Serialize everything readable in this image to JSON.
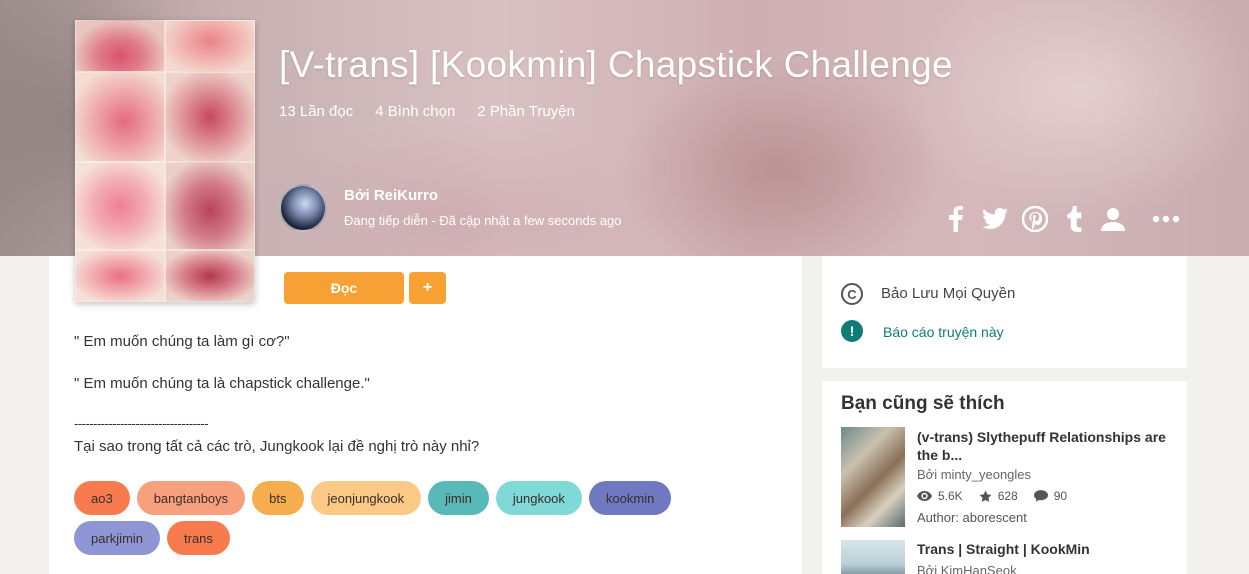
{
  "story": {
    "title": "[V-trans] [Kookmin] Chapstick Challenge",
    "reads": "13 Lần đọc",
    "votes": "4 Bình chọn",
    "parts": "2 Phần Truyện",
    "author": "Bởi ReiKurro",
    "status": "Đang tiếp diễn - Đã cập nhật a few seconds ago"
  },
  "share_icons": [
    "facebook-icon",
    "twitter-icon",
    "pinterest-icon",
    "tumblr-icon",
    "profile-icon",
    "more-icon"
  ],
  "actions": {
    "read_label": "Đọc",
    "add_label": "+"
  },
  "description": {
    "line1": "\" Em muốn chúng ta làm gì cơ?\"",
    "line2": "\" Em muốn chúng ta là chapstick challenge.\"",
    "divider": "-----------------------------------",
    "line3": "Tại sao trong tất cả các trò, Jungkook lại đề nghị trò này nhỉ?"
  },
  "tags": [
    {
      "label": "ao3",
      "color": "#f77b4e"
    },
    {
      "label": "bangtanboys",
      "color": "#f7a07e"
    },
    {
      "label": "bts",
      "color": "#f7ad4e"
    },
    {
      "label": "jeonjungkook",
      "color": "#fbc986"
    },
    {
      "label": "jimin",
      "color": "#59b8b8"
    },
    {
      "label": "jungkook",
      "color": "#7fd9d6"
    },
    {
      "label": "kookmin",
      "color": "#6e79c1"
    },
    {
      "label": "parkjimin",
      "color": "#8e96d6"
    },
    {
      "label": "trans",
      "color": "#f77b4e"
    }
  ],
  "sidebar": {
    "copyright": "Bảo Lưu Mọi Quyền",
    "report": "Báo cáo truyện này",
    "recommend_heading": "Bạn cũng sẽ thích",
    "recommendations": [
      {
        "title": "(v-trans) Slythepuff Relationships are the b...",
        "by": "Bởi minty_yeongles",
        "reads": "5.6K",
        "votes": "628",
        "comments": "90",
        "extra": "Author: aborescent"
      },
      {
        "title": "Trans | Straight | KookMin",
        "by": "Bởi KimHanSeok"
      }
    ]
  },
  "colors": {
    "accent": "#f7a134",
    "link": "#0e7d76"
  }
}
